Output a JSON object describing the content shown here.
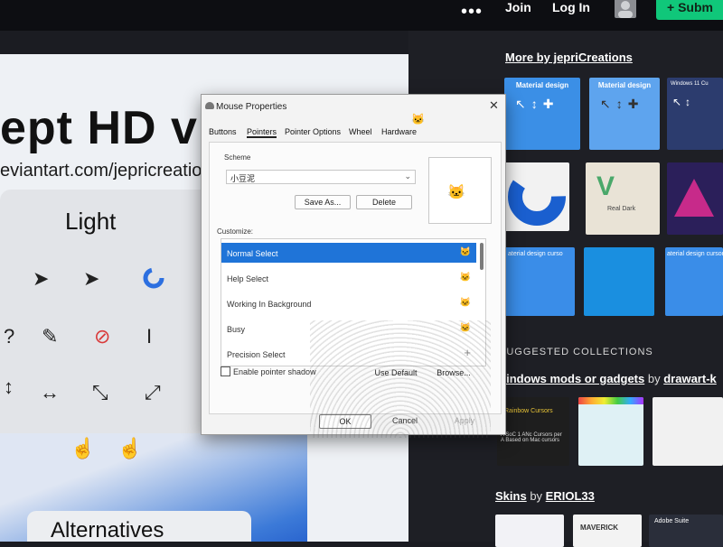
{
  "topbar": {
    "more_icon": "ellipsis-icon",
    "join": "Join",
    "login": "Log In",
    "submit": "+ Subm"
  },
  "deviation": {
    "title": "ept HD v",
    "url": "eviantart.com/jepricreatio",
    "light_label": "Light",
    "alternatives_label": "Alternatives"
  },
  "sidebar": {
    "more_by": "More by jepriCreations",
    "thumbs_row1": [
      "Material design",
      "Material design",
      "Windows 11 Cu"
    ],
    "thumbs_row2_text": [
      "",
      "Real Dark",
      ""
    ],
    "thumbs_row3": [
      "aterial design curso",
      "",
      "aterial design cursor"
    ],
    "suggested_header": "SUGGESTED COLLECTIONS",
    "collection1": {
      "name": "windows mods or gadgets",
      "by": "by",
      "author": "drawart-k"
    },
    "collection1_thumb_caption": "Rainbow Cursors",
    "collection1_thumb_sub": "A SoC 1 ANc Cursors per A Based on Mac cursors",
    "collection2": {
      "name": "Skins",
      "by": "by",
      "author": "ERIOL33"
    },
    "collection2_thumbs": [
      "",
      "MAVERICK",
      "Adobe Suite"
    ]
  },
  "dialog": {
    "title": "Mouse Properties",
    "close": "✕",
    "tabs": [
      "Buttons",
      "Pointers",
      "Pointer Options",
      "Wheel",
      "Hardware"
    ],
    "active_tab": "Pointers",
    "scheme_label": "Scheme",
    "scheme_value": "小豆泥",
    "save_as": "Save As...",
    "delete": "Delete",
    "customize_label": "Customize:",
    "rows": [
      {
        "label": "Normal Select",
        "selected": true
      },
      {
        "label": "Help Select",
        "selected": false
      },
      {
        "label": "Working In Background",
        "selected": false
      },
      {
        "label": "Busy",
        "selected": false
      },
      {
        "label": "Precision Select",
        "selected": false
      }
    ],
    "enable_shadow": "Enable pointer shadow",
    "use_default": "Use Default",
    "browse": "Browse...",
    "ok": "OK",
    "cancel": "Cancel",
    "apply": "Apply"
  },
  "colors": {
    "accent": "#1f74d8",
    "submit": "#10c77a",
    "sidebar_bg": "#1e1f25"
  }
}
